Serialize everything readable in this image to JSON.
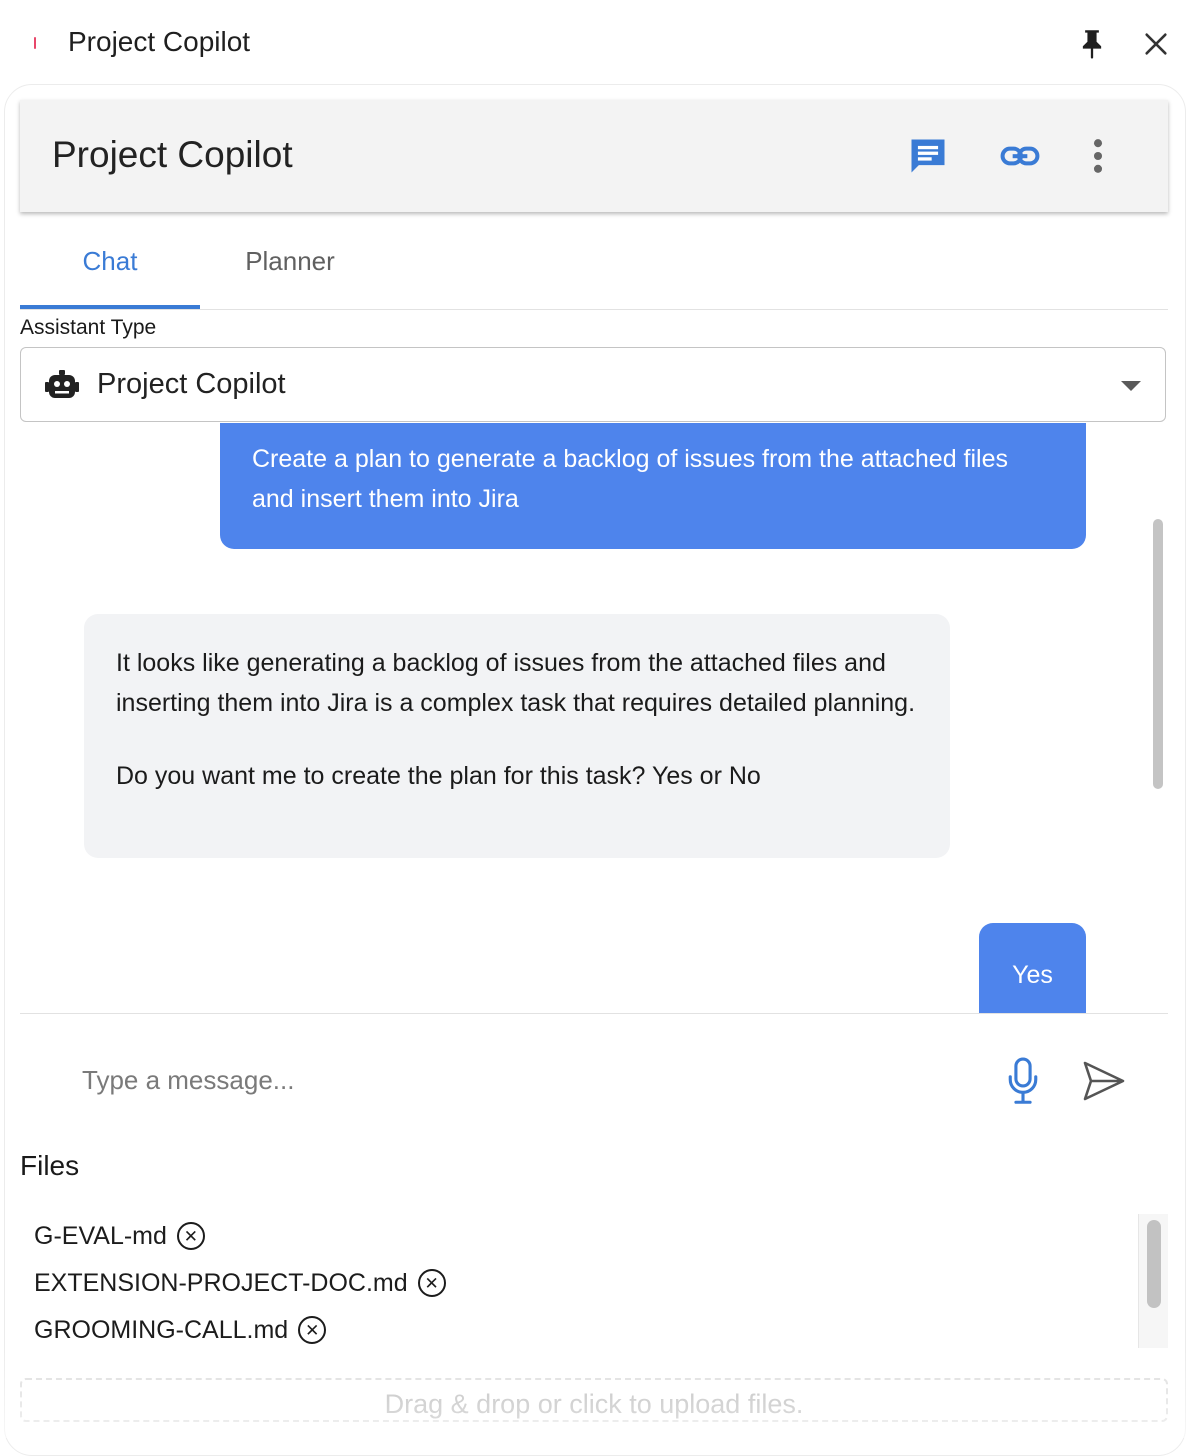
{
  "window": {
    "title": "Project Copilot",
    "pin_icon": "pin-icon",
    "close_icon": "close-icon"
  },
  "header": {
    "title": "Project Copilot",
    "icons": [
      "chat-icon",
      "link-icon",
      "more-vertical-icon"
    ],
    "accent_color": "#3a7bd5"
  },
  "tabs": [
    {
      "label": "Chat",
      "active": true
    },
    {
      "label": "Planner",
      "active": false
    }
  ],
  "assistant": {
    "label": "Assistant Type",
    "selected": "Project Copilot",
    "icon": "robot-icon"
  },
  "messages": {
    "user_1": "Create a plan to generate a backlog of issues from the attached files and insert them into Jira",
    "bot_1_p1": "It looks like generating a backlog of issues from the attached files and inserting them into Jira is a complex task that requires detailed planning.",
    "bot_1_p2": "Do you want me to create the plan for this task? Yes or No",
    "user_2": "Yes",
    "user_bubble_color": "#4e84ec",
    "bot_bubble_color": "#f2f3f5"
  },
  "composer": {
    "placeholder": "Type a message...",
    "mic_icon": "microphone-icon",
    "send_icon": "send-icon"
  },
  "files": {
    "label": "Files",
    "items": [
      "G-EVAL-md",
      "EXTENSION-PROJECT-DOC.md",
      "GROOMING-CALL.md"
    ],
    "dropzone": "Drag & drop or click to upload files."
  }
}
